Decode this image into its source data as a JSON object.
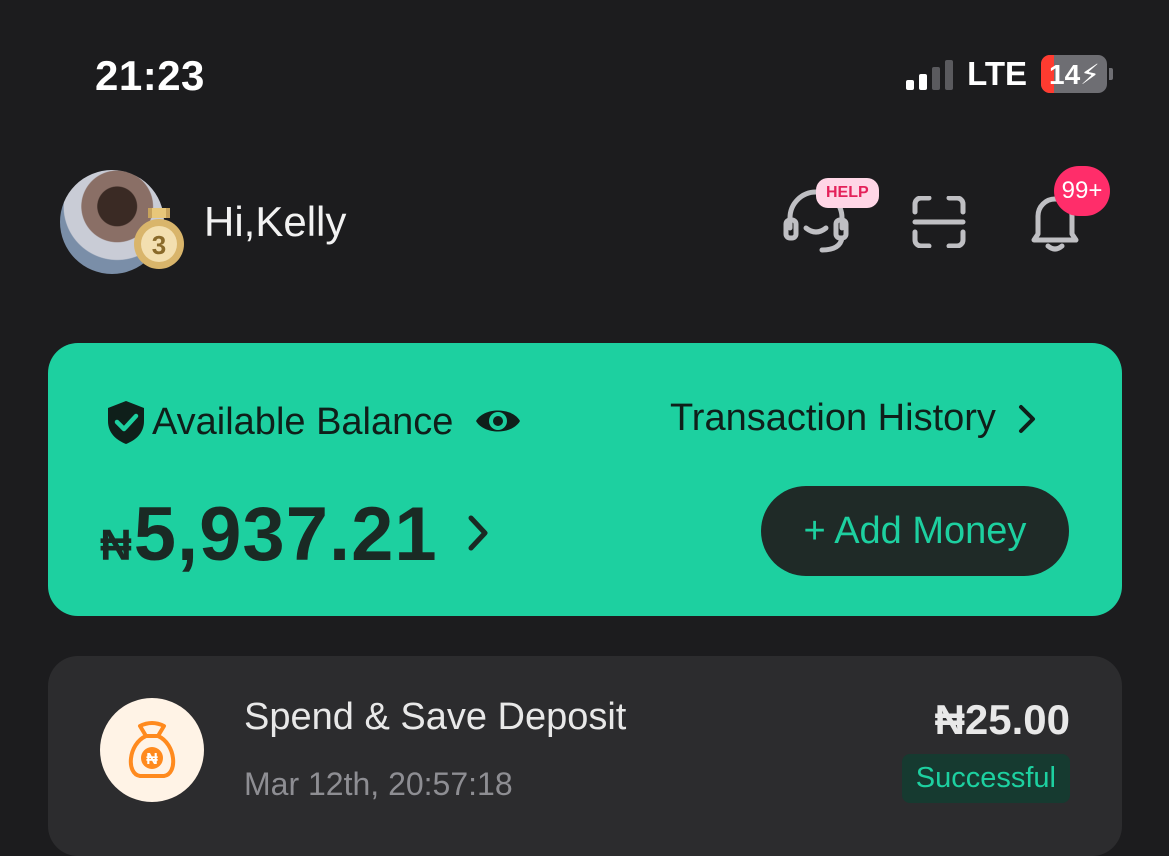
{
  "status_bar": {
    "time": "21:23",
    "network": "LTE",
    "battery": "14"
  },
  "header": {
    "greeting": "Hi,Kelly",
    "medal_level": "3",
    "help_badge": "HELP",
    "notification_count": "99+"
  },
  "balance": {
    "label": "Available Balance",
    "transaction_history_label": "Transaction History",
    "currency": "₦",
    "amount": "5,937.21",
    "add_money_label": "+ Add Money"
  },
  "transactions": [
    {
      "title": "Spend & Save Deposit",
      "time": "Mar 12th, 20:57:18",
      "amount": "₦25.00",
      "status": "Successful"
    }
  ],
  "colors": {
    "accent": "#1dd0a0",
    "background": "#1c1c1e",
    "card": "#2c2c2e",
    "badge": "#ff2d6a"
  }
}
